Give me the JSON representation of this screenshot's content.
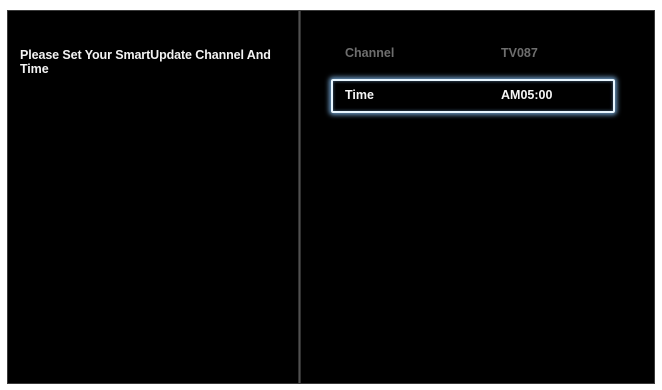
{
  "prompt": {
    "text": "Please Set Your SmartUpdate Channel And Time"
  },
  "settings": {
    "rows": [
      {
        "label": "Channel",
        "value": "TV087",
        "state": "normal"
      },
      {
        "label": "Time",
        "value": "AM05:00",
        "state": "focused"
      }
    ]
  },
  "colors": {
    "background": "#000000",
    "text_active": "#f5f5f5",
    "text_inactive": "#6e6e6e",
    "focus_glow": "#8cc8ff"
  }
}
